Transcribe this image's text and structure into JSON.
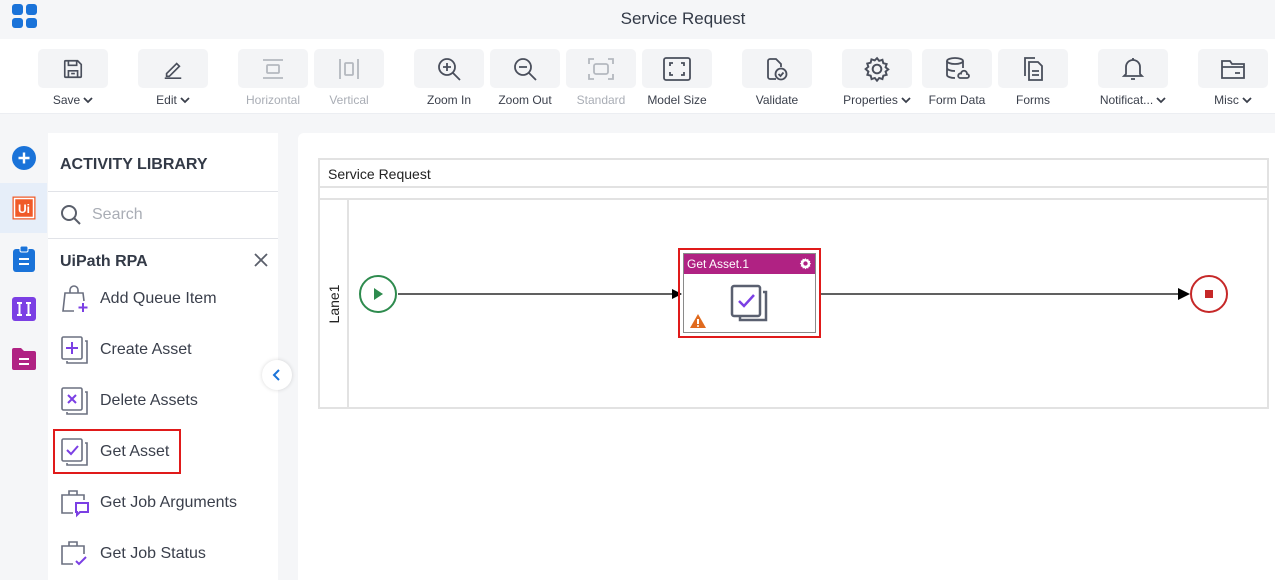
{
  "window": {
    "title": "Service Request"
  },
  "toolbar": [
    {
      "id": "save",
      "label": "Save",
      "icon": "save-icon",
      "dropdown": true,
      "disabled": false
    },
    {
      "id": "edit",
      "label": "Edit",
      "icon": "pencil-icon",
      "dropdown": true,
      "disabled": false
    },
    {
      "id": "horizontal",
      "label": "Horizontal",
      "icon": "horizontal-align-icon",
      "dropdown": false,
      "disabled": true
    },
    {
      "id": "vertical",
      "label": "Vertical",
      "icon": "vertical-align-icon",
      "dropdown": false,
      "disabled": true
    },
    {
      "id": "zoom-in",
      "label": "Zoom In",
      "icon": "zoom-in-icon",
      "dropdown": false,
      "disabled": false
    },
    {
      "id": "zoom-out",
      "label": "Zoom Out",
      "icon": "zoom-out-icon",
      "dropdown": false,
      "disabled": false
    },
    {
      "id": "standard",
      "label": "Standard",
      "icon": "standard-size-icon",
      "dropdown": false,
      "disabled": true
    },
    {
      "id": "model-size",
      "label": "Model Size",
      "icon": "model-size-icon",
      "dropdown": false,
      "disabled": false
    },
    {
      "id": "validate",
      "label": "Validate",
      "icon": "validate-icon",
      "dropdown": false,
      "disabled": false
    },
    {
      "id": "properties",
      "label": "Properties",
      "icon": "gear-icon",
      "dropdown": true,
      "disabled": false
    },
    {
      "id": "form-data",
      "label": "Form Data",
      "icon": "database-icon",
      "dropdown": false,
      "disabled": false
    },
    {
      "id": "forms",
      "label": "Forms",
      "icon": "forms-icon",
      "dropdown": false,
      "disabled": false
    },
    {
      "id": "notifications",
      "label": "Notificat...",
      "icon": "bell-icon",
      "dropdown": true,
      "disabled": false
    },
    {
      "id": "misc",
      "label": "Misc",
      "icon": "folder-icon",
      "dropdown": true,
      "disabled": false
    }
  ],
  "rail": [
    {
      "name": "add",
      "icon": "plus-circle-icon",
      "color": "#1a73d9"
    },
    {
      "name": "uipath",
      "icon": "uipath-icon",
      "color": "#f05a28",
      "active": true
    },
    {
      "name": "clipboard",
      "icon": "clipboard-icon",
      "color": "#1a73d9"
    },
    {
      "name": "integration",
      "icon": "integration-icon",
      "color": "#7b3fe4"
    },
    {
      "name": "folder",
      "icon": "folder-icon",
      "color": "#b02283"
    }
  ],
  "library": {
    "title": "ACTIVITY LIBRARY",
    "search_placeholder": "Search",
    "group": "UiPath RPA",
    "items": [
      {
        "label": "Add Queue Item",
        "icon": "add-queue-item-icon"
      },
      {
        "label": "Create Asset",
        "icon": "create-asset-icon"
      },
      {
        "label": "Delete Assets",
        "icon": "delete-assets-icon"
      },
      {
        "label": "Get Asset",
        "icon": "get-asset-icon",
        "highlighted": true
      },
      {
        "label": "Get Job Arguments",
        "icon": "get-job-arguments-icon"
      },
      {
        "label": "Get Job Status",
        "icon": "get-job-status-icon"
      }
    ]
  },
  "canvas": {
    "pool_title": "Service Request",
    "lane_label": "Lane1",
    "task": {
      "label": "Get Asset.1",
      "warning": true
    },
    "colors": {
      "task_header": "#b02283",
      "start": "#2e8b4e",
      "end": "#c62828",
      "highlight": "#e01a1a"
    }
  }
}
